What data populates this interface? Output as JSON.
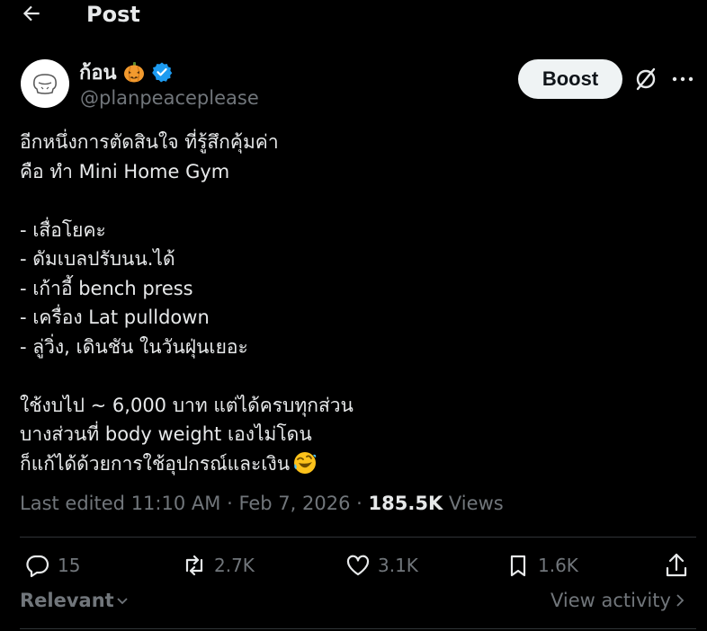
{
  "header": {
    "title": "Post",
    "back_icon": "arrow-left-icon"
  },
  "author": {
    "display_name": "ก้อน",
    "handle": "@planpeaceplease",
    "name_emoji": "pumpkin-icon",
    "verified_icon": "verified-badge-icon",
    "verified_color": "#1d9bf0"
  },
  "actions_top": {
    "boost_label": "Boost",
    "grok_icon": "grok-icon",
    "more_icon": "more-horizontal-icon"
  },
  "post": {
    "lines": [
      "อีกหนึ่งการตัดสินใจ ที่รู้สึกคุ้มค่า",
      "คือ ทำ Mini Home Gym",
      "",
      "- เสื่อโยคะ",
      "- ดัมเบลปรับนน.ได้",
      "- เก้าอี้ bench press",
      "- เครื่อง Lat pulldown",
      "- ลู่วิ่ง, เดินชัน ในวันฝุ่นเยอะ",
      "",
      "ใช้งบไป ~ 6,000 บาท แต่ได้ครบทุกส่วน",
      "บางส่วนที่ body weight เองไม่โดน",
      "ก็แก้ได้ด้วยการใช้อุปกรณ์และเงิน"
    ],
    "trailing_emoji": "rolling-on-floor-laughing-icon"
  },
  "meta": {
    "edited_label": "Last edited",
    "time": "11:10 AM",
    "separator": "·",
    "date": "Feb 7, 2026",
    "views_count": "185.5K",
    "views_label": "Views"
  },
  "engagement": {
    "replies": "15",
    "reposts": "2.7K",
    "likes": "3.1K",
    "bookmarks": "1.6K"
  },
  "footer": {
    "sort_label": "Relevant",
    "view_activity_label": "View activity"
  },
  "colors": {
    "background": "#000000",
    "text": "#e7e9ea",
    "muted": "#71767b",
    "divider": "#2f3336",
    "boost_bg": "#eff3f4"
  }
}
